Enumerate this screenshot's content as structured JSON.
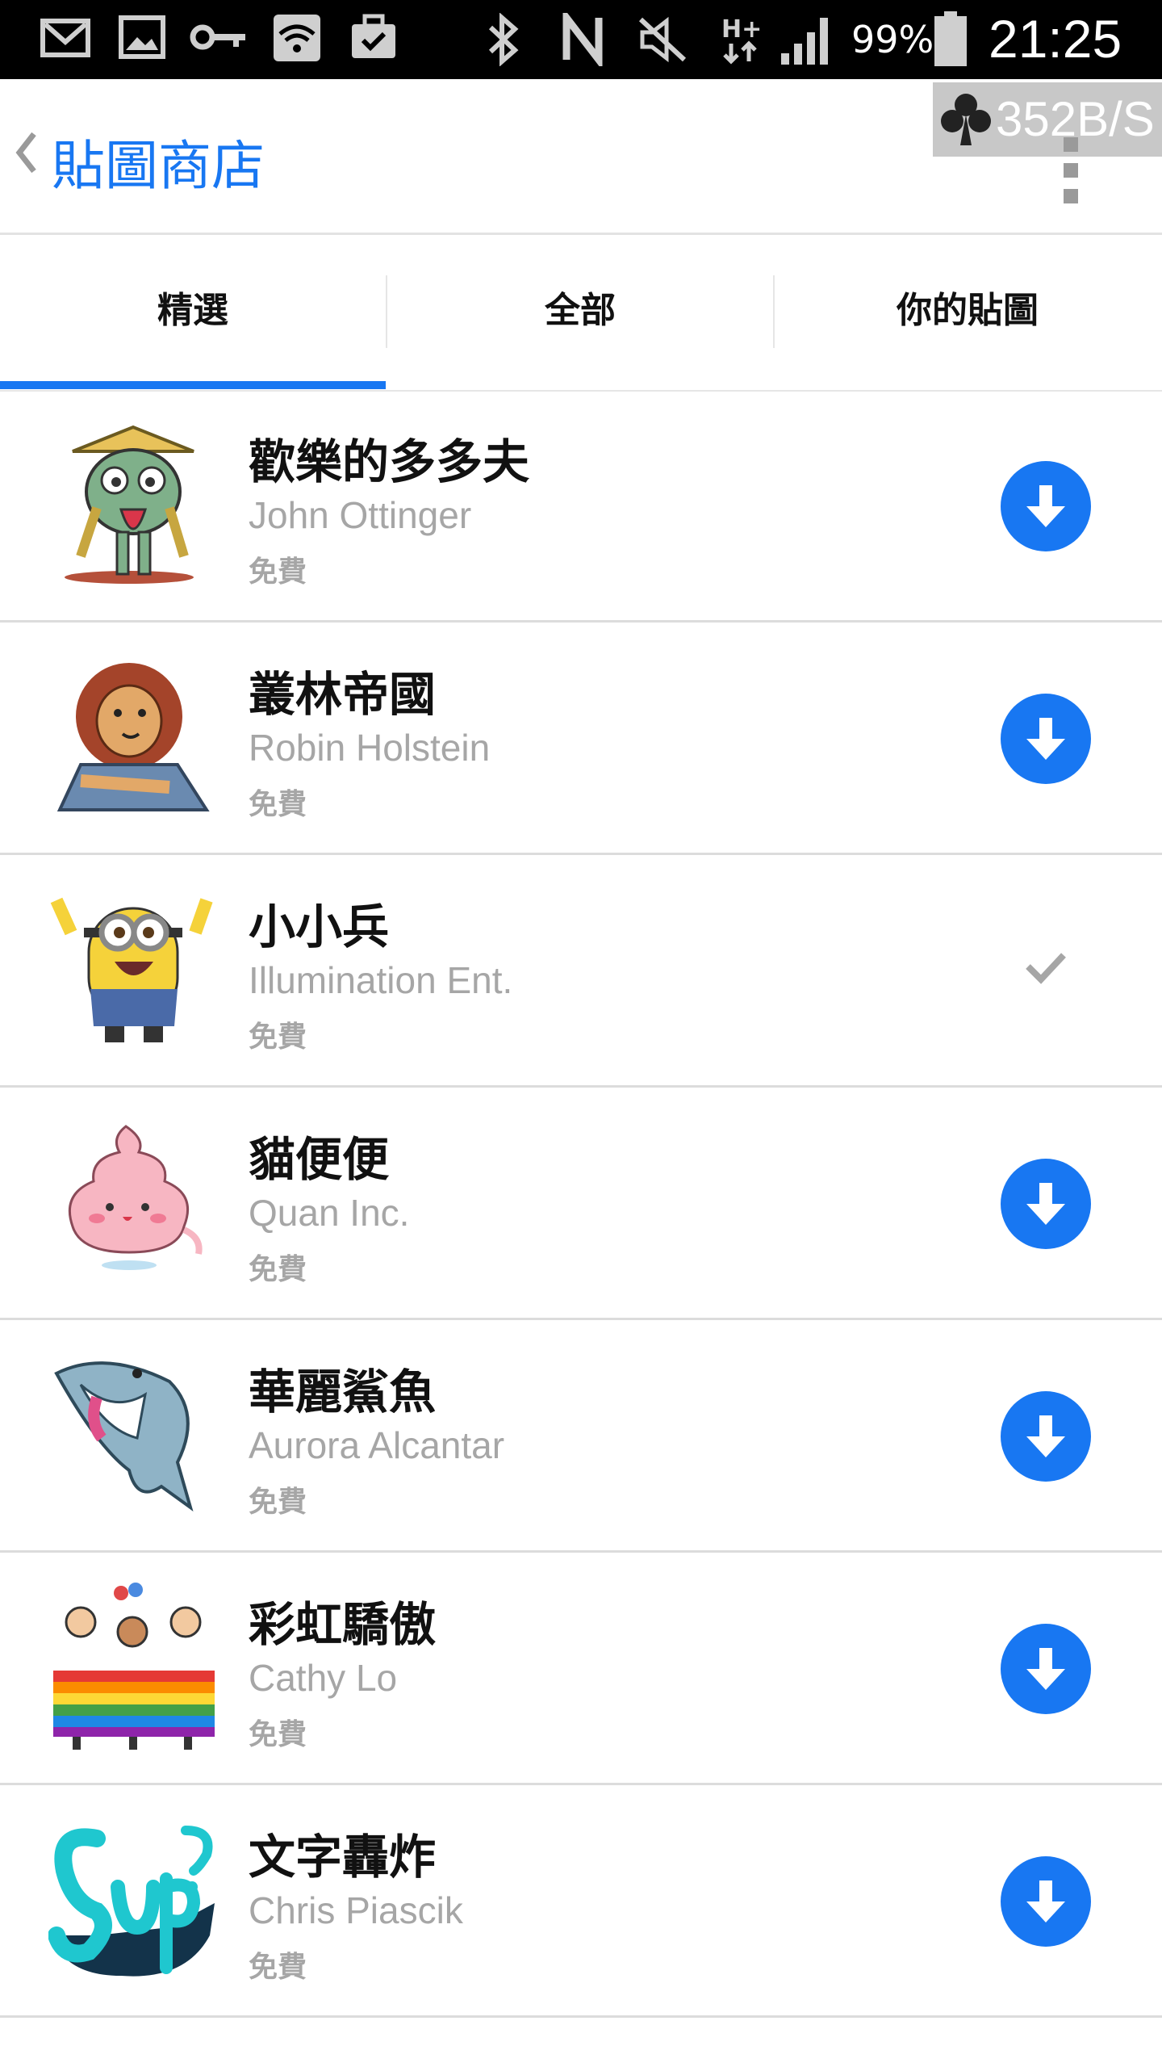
{
  "status_bar": {
    "battery_percent": "99%",
    "time": "21:25"
  },
  "app_bar": {
    "title": "貼圖商店",
    "net_speed": "352B/S"
  },
  "tabs": [
    {
      "label": "精選",
      "selected": true
    },
    {
      "label": "全部",
      "selected": false
    },
    {
      "label": "你的貼圖",
      "selected": false
    }
  ],
  "stickers": [
    {
      "name": "歡樂的多多夫",
      "author": "John Ottinger",
      "price": "免費",
      "status": "download"
    },
    {
      "name": "叢林帝國",
      "author": "Robin Holstein",
      "price": "免費",
      "status": "download"
    },
    {
      "name": "小小兵",
      "author": "Illumination Ent.",
      "price": "免費",
      "status": "installed"
    },
    {
      "name": "貓便便",
      "author": "Quan Inc.",
      "price": "免費",
      "status": "download"
    },
    {
      "name": "華麗鯊魚",
      "author": "Aurora Alcantar",
      "price": "免費",
      "status": "download"
    },
    {
      "name": "彩虹驕傲",
      "author": "Cathy Lo",
      "price": "免費",
      "status": "download"
    },
    {
      "name": "文字轟炸",
      "author": "Chris Piascik",
      "price": "免費",
      "status": "download"
    }
  ],
  "colors": {
    "accent": "#1877f2",
    "secondary_text": "#a6a6a6",
    "status_bar": "#000000"
  }
}
